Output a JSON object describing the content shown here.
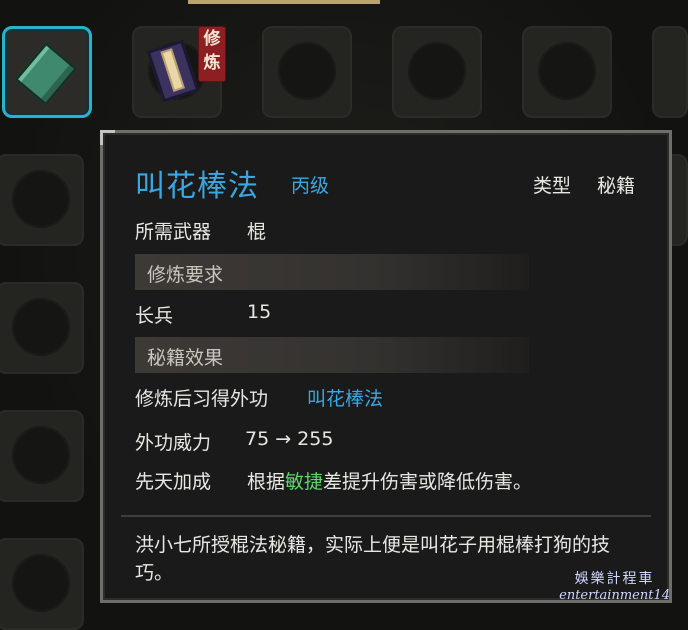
{
  "inventory": {
    "slot2_badge": "修\n炼"
  },
  "tooltip": {
    "title": "叫花棒法",
    "grade": "丙级",
    "type_label": "类型",
    "type_value": "秘籍",
    "weapon_label": "所需武器",
    "weapon_value": "棍",
    "requirement_header": "修炼要求",
    "requirement_label": "长兵",
    "requirement_value": "15",
    "effect_header": "秘籍效果",
    "learn_text": "修炼后习得外功",
    "learn_value": "叫花棒法",
    "power_label": "外功威力",
    "power_value": "75 → 255",
    "innate_label": "先天加成",
    "innate_prefix": "根据",
    "innate_stat": "敏捷",
    "innate_suffix": "差提升伤害或降低伤害。",
    "description": "洪小七所授棍法秘籍，实际上便是叫花子用棍棒打狗的技巧。"
  },
  "watermark": {
    "cn": "娛樂計程車",
    "en": "entertainment14"
  },
  "colors": {
    "accent_blue": "#39a8e2",
    "highlight_green": "#5cd66b",
    "selected_border": "#2ab2cc",
    "badge_red": "#8d1f23"
  }
}
